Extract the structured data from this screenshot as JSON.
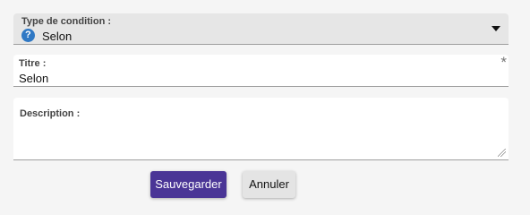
{
  "condition_type": {
    "label": "Type de condition :",
    "value": "Selon",
    "icon": "question-diamond-icon",
    "accent": "#2f78c4"
  },
  "title_field": {
    "label": "Titre :",
    "value": "Selon",
    "required_marker": "*"
  },
  "description_field": {
    "label": "Description :",
    "value": ""
  },
  "actions": {
    "save_label": "Sauvegarder",
    "cancel_label": "Annuler",
    "save_color": "#4a3596"
  }
}
